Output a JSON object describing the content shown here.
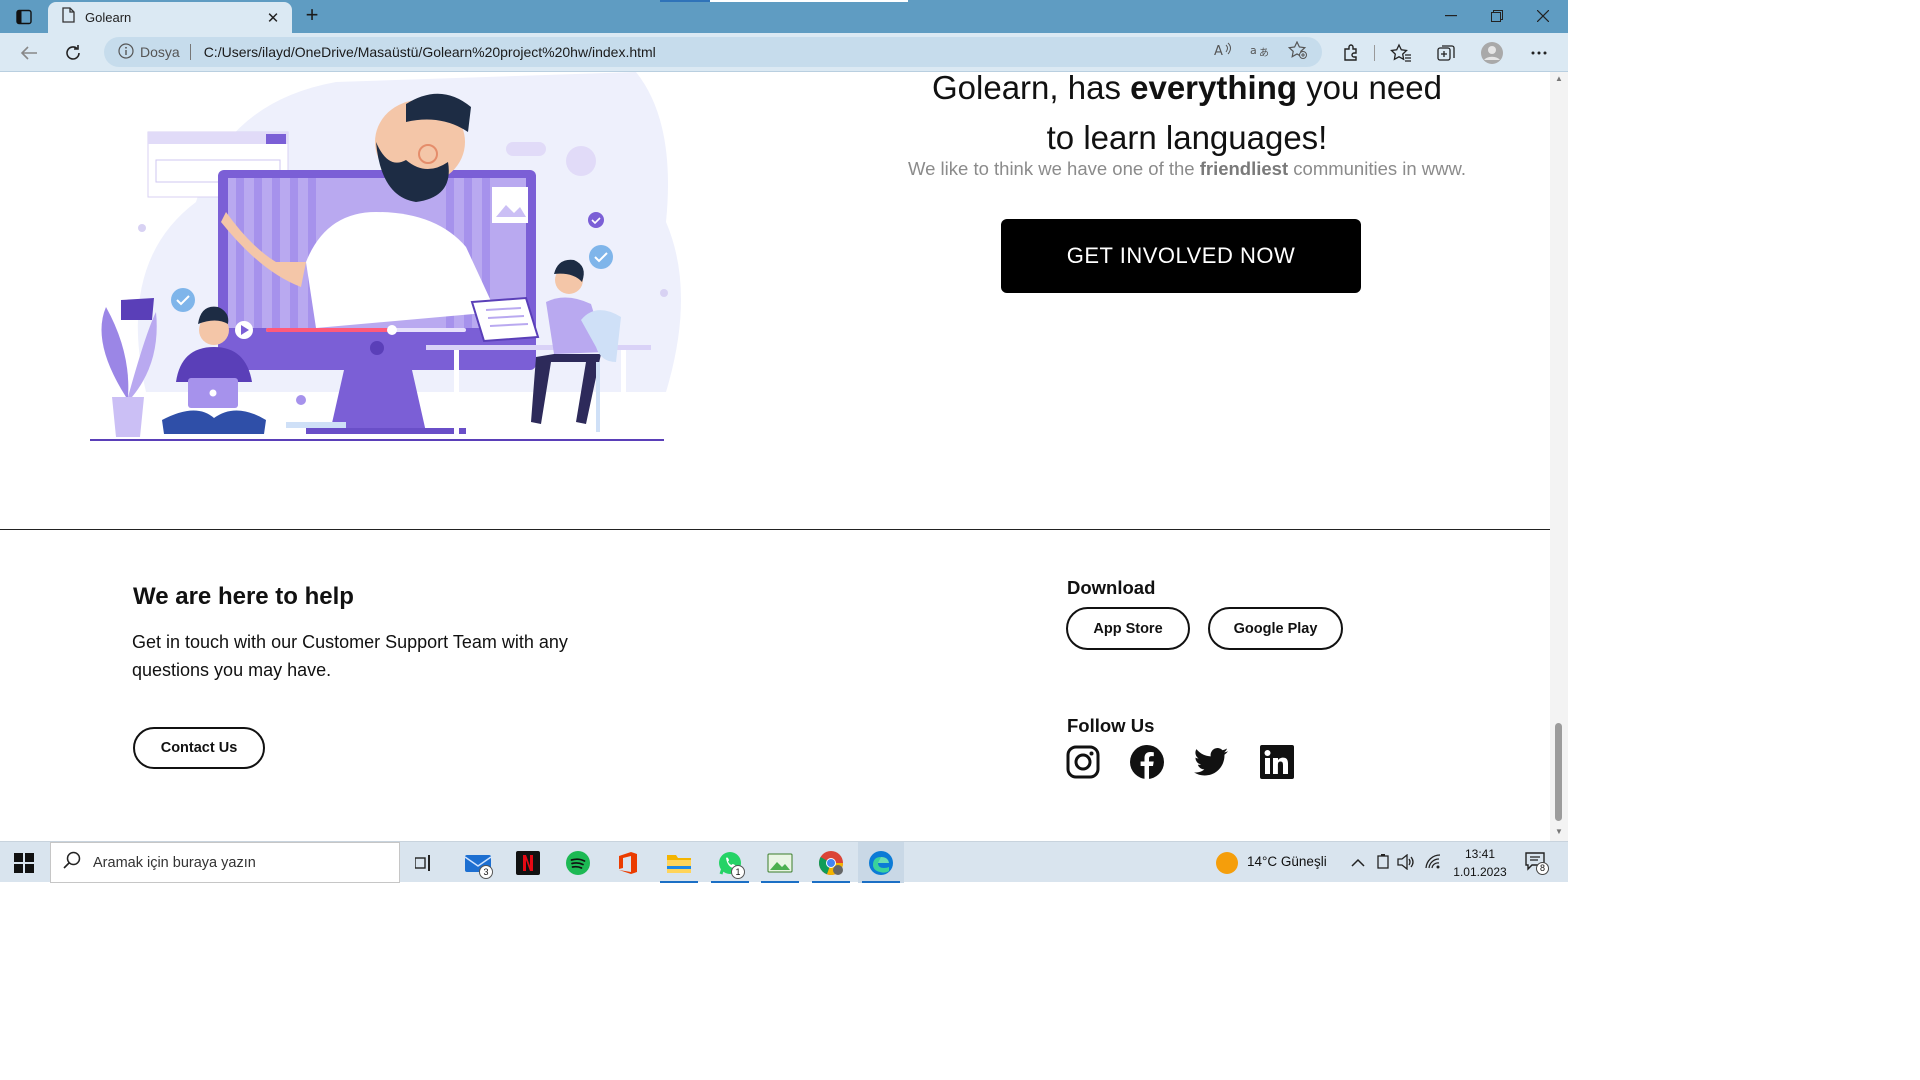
{
  "browser": {
    "tab_title": "Golearn",
    "address_prefix": "Dosya",
    "url": "C:/Users/ilayd/OneDrive/Masaüstü/Golearn%20project%20hw/index.html"
  },
  "hero": {
    "title_part1": "Golearn, has ",
    "title_bold": "everything",
    "title_part2": " you need",
    "title_line2": "to learn languages!",
    "subtitle_part1": "We like to think we have one of the ",
    "subtitle_bold": "friendliest",
    "subtitle_part2": " communities in www.",
    "cta_label": "GET INVOLVED NOW"
  },
  "footer": {
    "help_title": "We are here to help",
    "help_text": "Get in touch with our Customer Support Team with any questions you may have.",
    "contact_label": "Contact Us",
    "download_title": "Download",
    "app_store_label": "App Store",
    "google_play_label": "Google Play",
    "follow_title": "Follow Us",
    "social_icons": [
      "instagram-icon",
      "facebook-icon",
      "twitter-icon",
      "linkedin-icon"
    ]
  },
  "taskbar": {
    "search_placeholder": "Aramak için buraya yazın",
    "mail_badge": "3",
    "whatsapp_badge": "1",
    "weather": "14°C  Güneşli",
    "time": "13:41",
    "date": "1.01.2023",
    "notification_count": "8"
  },
  "colors": {
    "tabbar": "#5f9cc2",
    "addressbar": "#dbe9f3",
    "accent_purple": "#7b5fd6",
    "cta_bg": "#000000"
  }
}
